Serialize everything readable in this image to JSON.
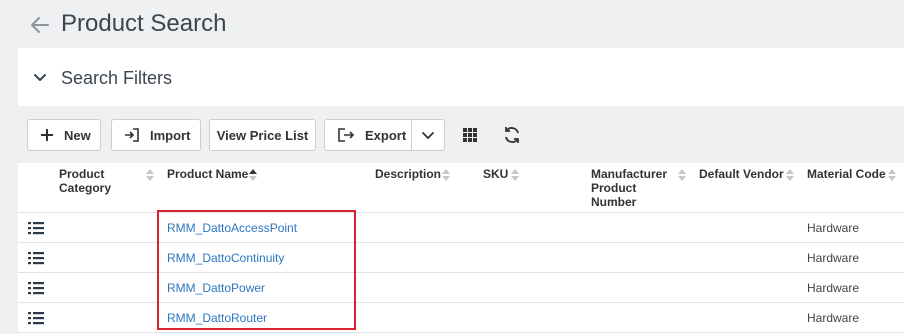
{
  "header": {
    "title": "Product Search"
  },
  "filters": {
    "title": "Search Filters"
  },
  "toolbar": {
    "new_label": "New",
    "import_label": "Import",
    "view_price_list_label": "View Price List",
    "export_label": "Export"
  },
  "table": {
    "columns": {
      "product_category": "Product Category",
      "product_name": "Product Name",
      "description": "Description",
      "sku": "SKU",
      "manufacturer_product_number": "Manufacturer Product Number",
      "default_vendor": "Default Vendor",
      "material_code": "Material Code"
    },
    "sorted_column": "Product Name",
    "sort_direction": "ascending",
    "rows": [
      {
        "product_category": "",
        "product_name": "RMM_DattoAccessPoint",
        "description": "",
        "sku": "",
        "manufacturer_product_number": "",
        "default_vendor": "",
        "material_code": "Hardware"
      },
      {
        "product_category": "",
        "product_name": "RMM_DattoContinuity",
        "description": "",
        "sku": "",
        "manufacturer_product_number": "",
        "default_vendor": "",
        "material_code": "Hardware"
      },
      {
        "product_category": "",
        "product_name": "RMM_DattoPower",
        "description": "",
        "sku": "",
        "manufacturer_product_number": "",
        "default_vendor": "",
        "material_code": "Hardware"
      },
      {
        "product_category": "",
        "product_name": "RMM_DattoRouter",
        "description": "",
        "sku": "",
        "manufacturer_product_number": "",
        "default_vendor": "",
        "material_code": "Hardware"
      }
    ]
  },
  "colors": {
    "link": "#2b77c0",
    "highlight": "#d9232d",
    "background": "#eef0f2"
  },
  "icons": [
    "back-arrow-icon",
    "chevron-down-icon",
    "plus-icon",
    "import-icon",
    "export-icon",
    "grid-icon",
    "refresh-icon",
    "list-icon",
    "sort-icon"
  ]
}
